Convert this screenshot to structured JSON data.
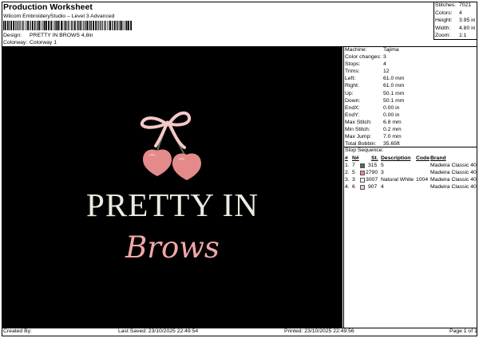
{
  "header": {
    "title": "Production Worksheet",
    "software": "Wilcom EmbroideryStudio – Level 3 Advanced",
    "design_label": "Design:",
    "design_value": "PRETTY IN BROWS 4,8in",
    "colorway_label": "Colorway:",
    "colorway_value": "Colorway 1"
  },
  "stats": [
    {
      "key": "Stitches:",
      "value": "7021"
    },
    {
      "key": "Colors:",
      "value": "4"
    },
    {
      "key": "Height:",
      "value": "3.95 in"
    },
    {
      "key": "Width:",
      "value": "4.80 in"
    },
    {
      "key": "Zoom:",
      "value": "1:1"
    }
  ],
  "specs": [
    {
      "key": "Machine:",
      "value": "Tajima"
    },
    {
      "key": "Color changes:",
      "value": "3"
    },
    {
      "key": "Stops:",
      "value": "4"
    },
    {
      "key": "Trims:",
      "value": "12"
    },
    {
      "key": "Left:",
      "value": "61.0 mm"
    },
    {
      "key": "Right:",
      "value": "61.0 mm"
    },
    {
      "key": "Up:",
      "value": "50.1 mm"
    },
    {
      "key": "Down:",
      "value": "50.1 mm"
    },
    {
      "key": "EndX:",
      "value": "0.00 in"
    },
    {
      "key": "EndY:",
      "value": "0.00 in"
    },
    {
      "key": "Max Stitch:",
      "value": "6.8 mm"
    },
    {
      "key": "Min Stitch:",
      "value": "0.2 mm"
    },
    {
      "key": "Max Jump:",
      "value": "7.0 mm"
    },
    {
      "key": "Total Bobbin:",
      "value": "35.65ft"
    }
  ],
  "stop_sequence": {
    "title": "Stop Sequence:",
    "headers": {
      "num": "#",
      "n": "N#",
      "st": "St.",
      "description": "Description",
      "code": "Code",
      "brand": "Brand"
    },
    "rows": [
      {
        "num": "1.",
        "n": "7",
        "color": "#4f6b4b",
        "st": "315",
        "description": "5",
        "code": "",
        "brand": "Madeira Classic 40"
      },
      {
        "num": "2.",
        "n": "5",
        "color": "#e58a8a",
        "st": "2790",
        "description": "3",
        "code": "",
        "brand": "Madeira Classic 40"
      },
      {
        "num": "3.",
        "n": "3",
        "color": "#f2f2ea",
        "st": "3007",
        "description": "Natural White",
        "code": "1004",
        "brand": "Madeira Classic 40"
      },
      {
        "num": "4.",
        "n": "6",
        "color": "#f5c8c8",
        "st": "907",
        "description": "4",
        "code": "",
        "brand": "Madeira Classic 40"
      }
    ]
  },
  "design": {
    "line1": "PRETTY IN",
    "line2": "Brows",
    "colors": {
      "background": "#000000",
      "cream": "#e8eedf",
      "pink": "#f0a8a8",
      "cherry": "#e58a8a",
      "stem": "#4f6b4b"
    }
  },
  "footer": {
    "created_by": "Created By:",
    "last_saved": "Last Saved: 23/10/2025 22:49:54",
    "printed": "Printed: 23/10/2025 22:49:56",
    "page": "Page 1 of 1"
  }
}
